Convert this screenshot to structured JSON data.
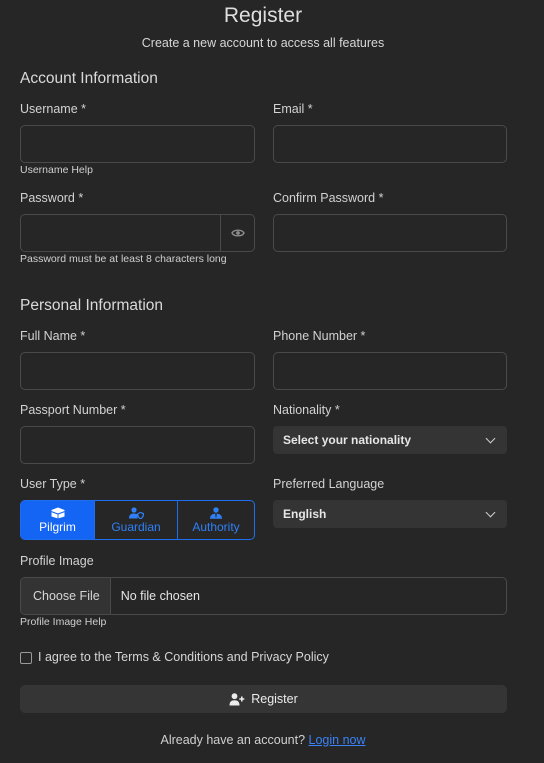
{
  "header": {
    "title": "Register",
    "subtitle": "Create a new account to access all features"
  },
  "account": {
    "heading": "Account Information",
    "username_label": "Username *",
    "username_help": "Username Help",
    "email_label": "Email *",
    "password_label": "Password *",
    "password_help": "Password must be at least 8 characters long",
    "confirm_password_label": "Confirm Password *"
  },
  "personal": {
    "heading": "Personal Information",
    "full_name_label": "Full Name *",
    "phone_label": "Phone Number *",
    "passport_label": "Passport Number *",
    "nationality_label": "Nationality *",
    "nationality_value": "Select your nationality",
    "user_type_label": "User Type *",
    "user_types": [
      "Pilgrim",
      "Guardian",
      "Authority"
    ],
    "user_type_selected": "Pilgrim",
    "language_label": "Preferred Language",
    "language_value": "English",
    "profile_image_label": "Profile Image",
    "choose_file_label": "Choose File",
    "file_status": "No file chosen",
    "profile_image_help": "Profile Image Help"
  },
  "terms": {
    "label": "I agree to the Terms & Conditions and Privacy Policy",
    "checked": false
  },
  "submit_label": "Register",
  "footer": {
    "prompt": "Already have an account?",
    "login_link": "Login now"
  },
  "colors": {
    "background": "#262626",
    "accent": "#1565f5",
    "link": "#3a82f6"
  },
  "icons": {
    "password_toggle": "eye-icon",
    "pilgrim": "kaaba-icon",
    "guardian": "user-shield-icon",
    "authority": "user-tie-icon",
    "submit": "user-plus-icon"
  }
}
